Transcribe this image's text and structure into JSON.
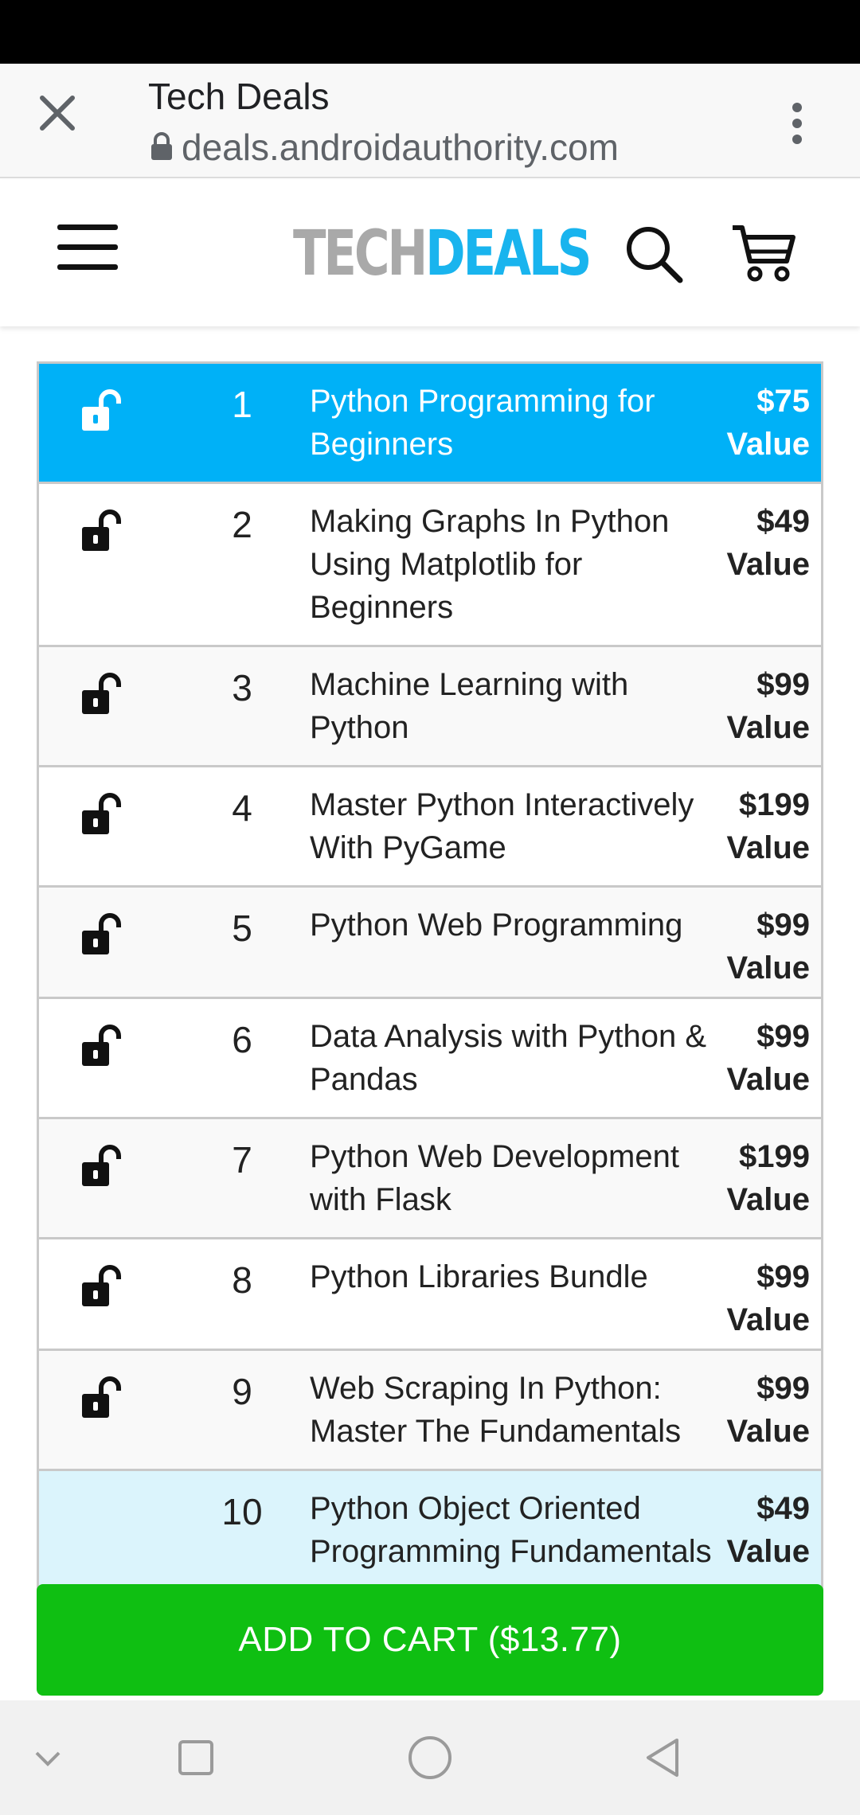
{
  "browser": {
    "title": "Tech Deals",
    "url": "deals.androidauthority.com"
  },
  "site": {
    "logo_part1": "TECH",
    "logo_part2": "DEALS"
  },
  "courses": [
    {
      "num": "1",
      "name": "Python Programming for Beginners",
      "price": "$75",
      "value_label": "Value",
      "style": "active"
    },
    {
      "num": "2",
      "name": "Making Graphs In Python Using Matplotlib for Beginners",
      "price": "$49",
      "value_label": "Value",
      "style": "white"
    },
    {
      "num": "3",
      "name": "Machine Learning with Python",
      "price": "$99",
      "value_label": "Value",
      "style": "alt"
    },
    {
      "num": "4",
      "name": "Master Python Interactively With PyGame",
      "price": "$199",
      "value_label": "Value",
      "style": "white"
    },
    {
      "num": "5",
      "name": "Python Web Programming",
      "price": "$99",
      "value_label": "Value",
      "style": "alt"
    },
    {
      "num": "6",
      "name": "Data Analysis with Python & Pandas",
      "price": "$99",
      "value_label": "Value",
      "style": "white"
    },
    {
      "num": "7",
      "name": "Python Web Development with Flask",
      "price": "$199",
      "value_label": "Value",
      "style": "alt"
    },
    {
      "num": "8",
      "name": "Python Libraries Bundle",
      "price": "$99",
      "value_label": "Value",
      "style": "white"
    },
    {
      "num": "9",
      "name": "Web Scraping In Python: Master The Fundamentals",
      "price": "$99",
      "value_label": "Value",
      "style": "alt"
    },
    {
      "num": "10",
      "name": "Python Object Oriented Programming Fundamentals",
      "price": "$49",
      "value_label": "Value",
      "style": "light"
    }
  ],
  "cta": {
    "label": "ADD TO CART ($13.77)"
  },
  "colors": {
    "accent": "#00b1f7",
    "cta": "#0fbf12",
    "highlight": "#dbf4fc"
  }
}
